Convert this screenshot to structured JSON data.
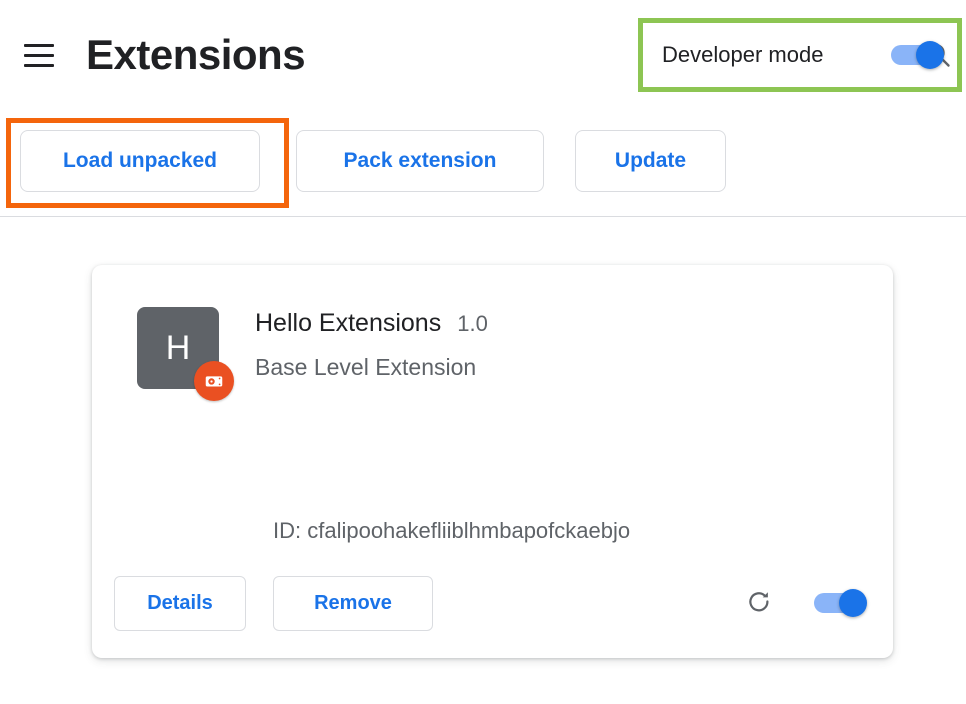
{
  "header": {
    "menu_icon": "hamburger-menu-icon",
    "title": "Extensions",
    "search_icon": "search-icon",
    "developer_mode": {
      "label": "Developer mode",
      "enabled": true,
      "highlight_color": "#8DC553"
    }
  },
  "toolbar": {
    "load_unpacked_label": "Load unpacked",
    "pack_extension_label": "Pack extension",
    "update_label": "Update",
    "highlight_color": "#F4650C",
    "accent_color": "#1A73E8"
  },
  "extension_card": {
    "icon_letter": "H",
    "icon_color": "#5F6368",
    "badge_icon": "unpacked-extension-badge-icon",
    "badge_color": "#EA5022",
    "name": "Hello Extensions",
    "version": "1.0",
    "description": "Base Level Extension",
    "id_text": "ID: cfalipoohakefliiblhmbapofckaebjo",
    "details_label": "Details",
    "remove_label": "Remove",
    "reload_icon": "reload-icon",
    "enabled": true
  }
}
